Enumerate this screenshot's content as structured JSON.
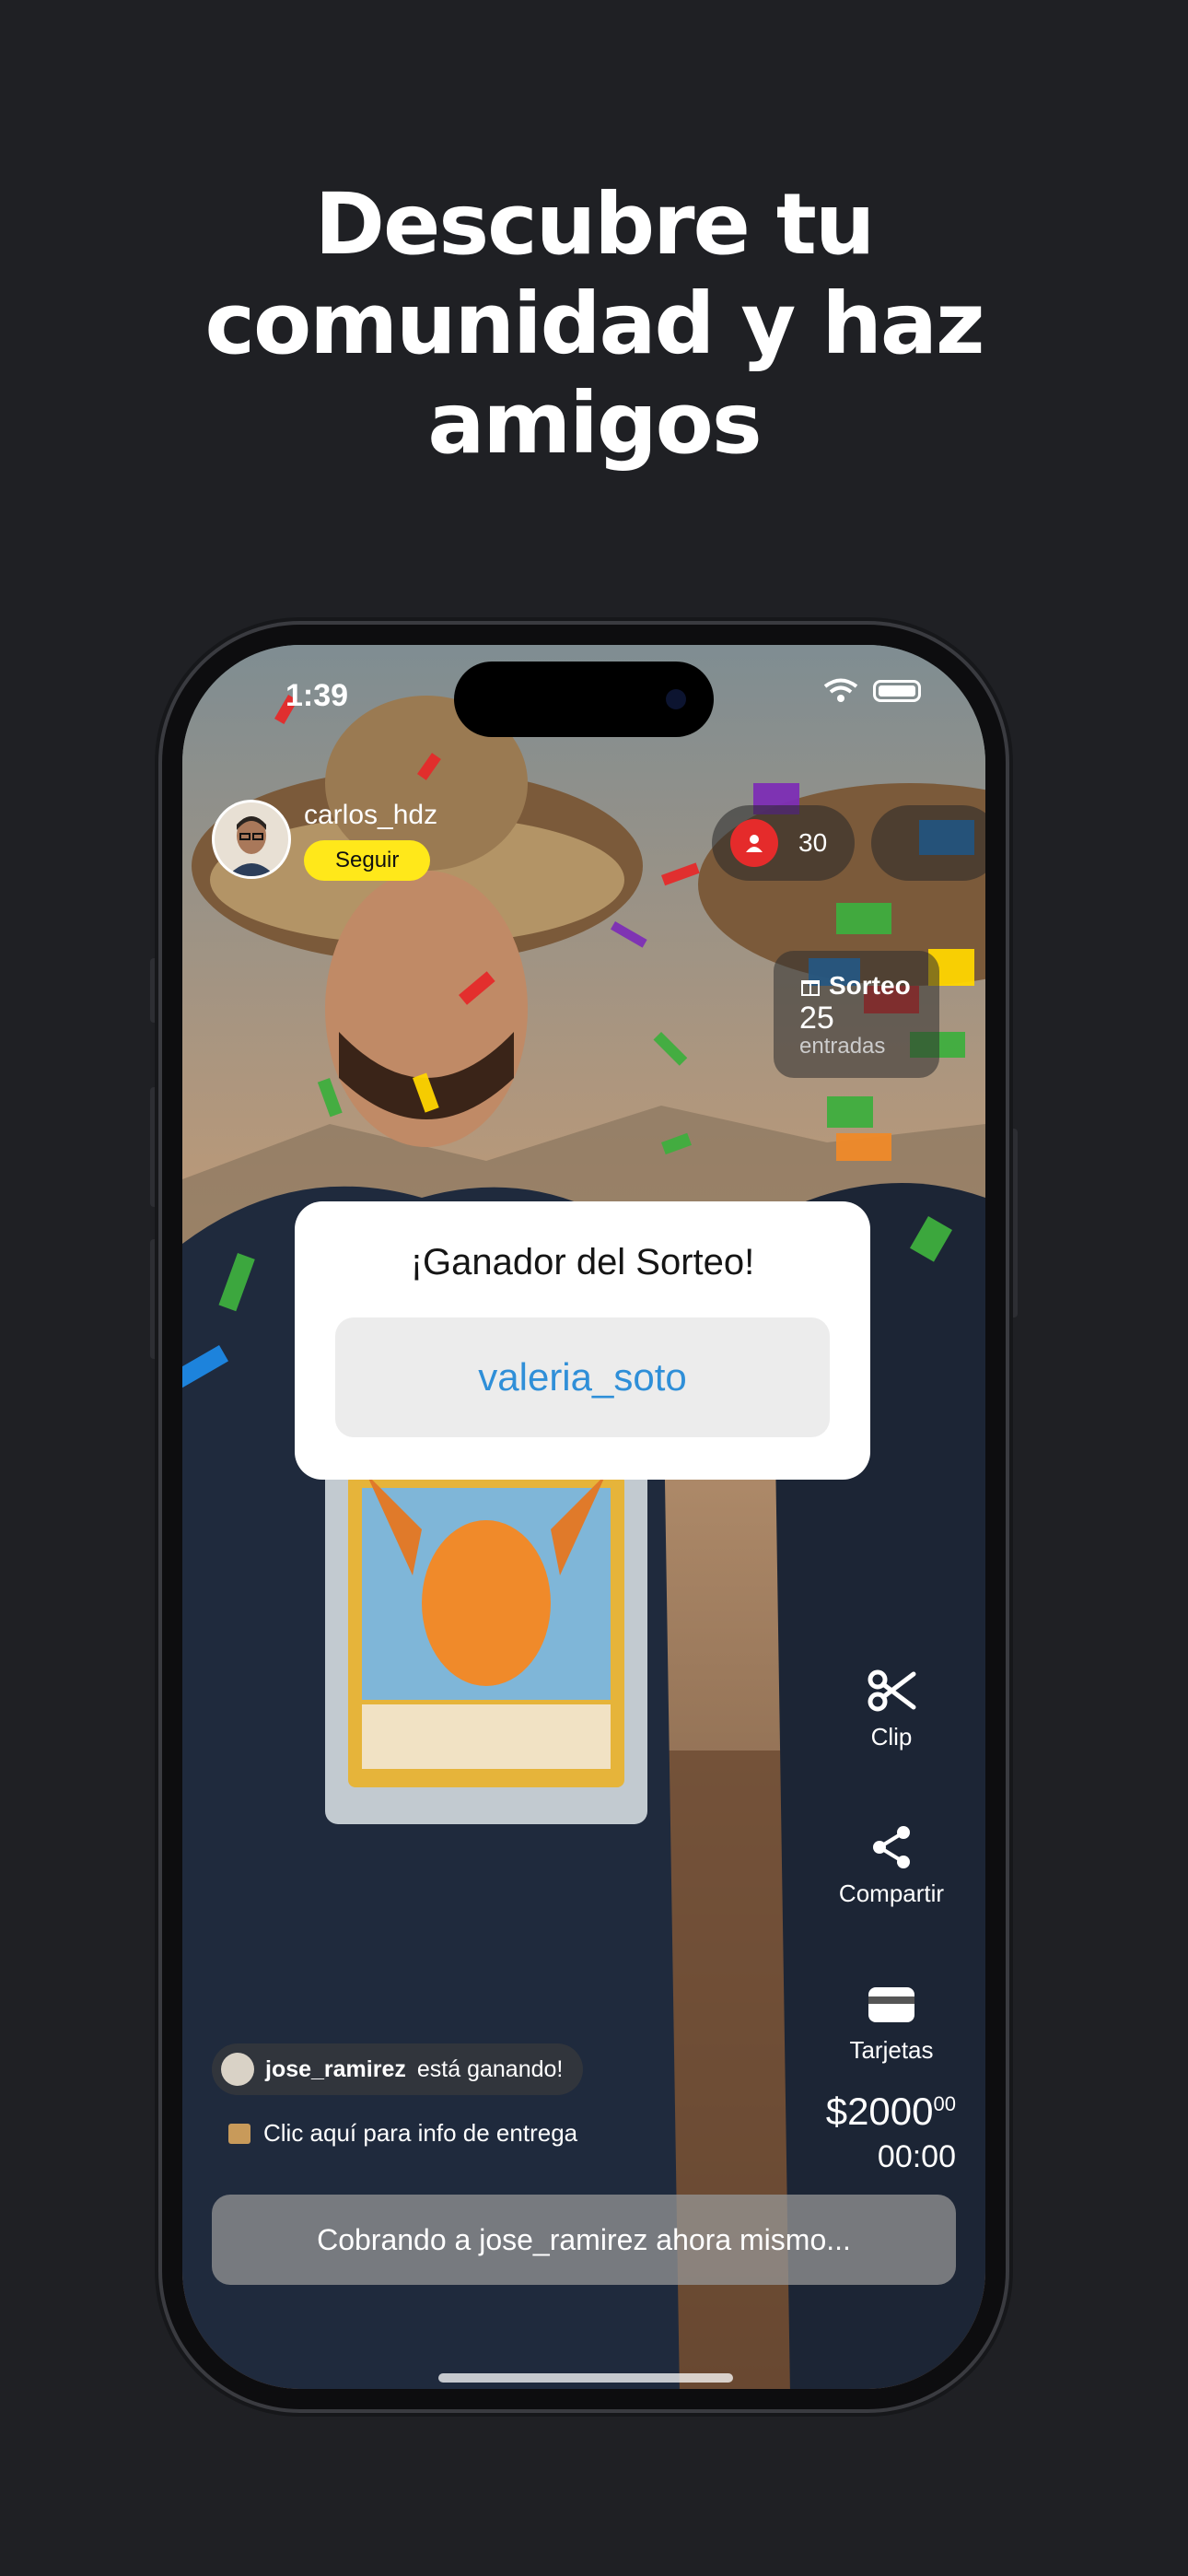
{
  "headline": [
    "Descubre tu",
    "comunidad y haz",
    "amigos"
  ],
  "status_bar": {
    "time": "1:39"
  },
  "host": {
    "username": "carlos_hdz",
    "follow_label": "Seguir"
  },
  "viewers": {
    "count": "30"
  },
  "raffle": {
    "title": "Sorteo",
    "count": "25",
    "label": "entradas"
  },
  "modal": {
    "title": "¡Ganador del Sorteo!",
    "winner": "valeria_soto"
  },
  "actions": [
    {
      "label": "Clip",
      "icon": "scissors-icon"
    },
    {
      "label": "Compartir",
      "icon": "share-icon"
    },
    {
      "label": "Tarjetas",
      "icon": "wallet-icon"
    }
  ],
  "price": {
    "main": "$2000",
    "cents": "00",
    "timer": "00:00"
  },
  "bid": {
    "username": "jose_ramirez",
    "text": "está ganando!"
  },
  "delivery": {
    "text": "Clic aquí para info de entrega"
  },
  "charging": {
    "text": "Cobrando a jose_ramirez ahora mismo..."
  },
  "colors": {
    "background": "#1f2024",
    "follow": "#ffe81a",
    "winner": "#2f8fd8",
    "viewer_badge": "#e52b2b"
  }
}
